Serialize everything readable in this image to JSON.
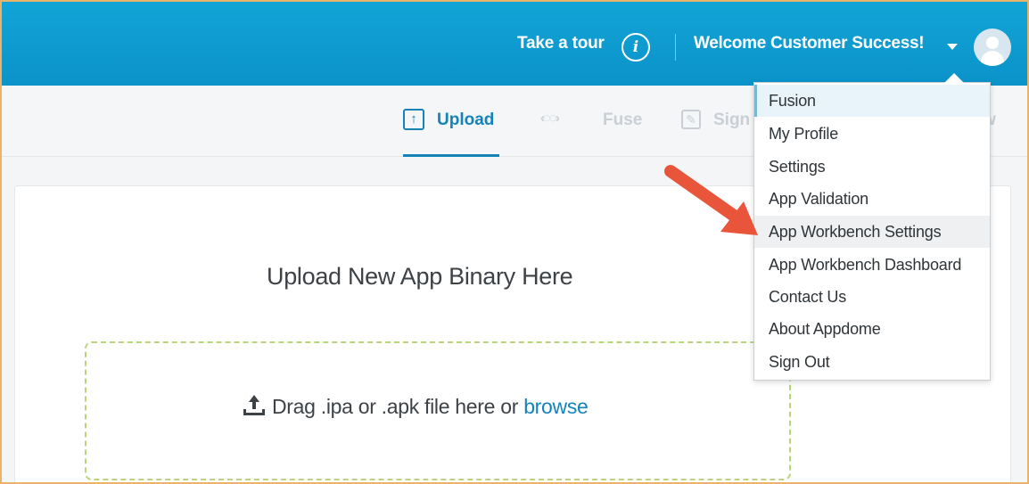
{
  "header": {
    "tour_label": "Take a tour",
    "info_glyph": "i",
    "welcome_label": "Welcome Customer Success!",
    "colors": {
      "bar": "#0b93c9",
      "text": "#ffffff"
    }
  },
  "steps": [
    {
      "label": "Upload",
      "active": true,
      "icon": "upload-box-icon"
    },
    {
      "label": "Fuse",
      "active": false,
      "icon": "fuse-connector-icon"
    },
    {
      "label": "Sign",
      "active": false,
      "icon": "pencil-edit-icon"
    },
    {
      "label": "w",
      "active": false
    }
  ],
  "main": {
    "title": "Upload New App Binary Here",
    "drop_text": "Drag .ipa or .apk file here or ",
    "browse_link": "browse"
  },
  "menu": {
    "items": [
      "Fusion",
      "My Profile",
      "Settings",
      "App Validation",
      "App Workbench Settings",
      "App Workbench Dashboard",
      "Contact Us",
      "About Appdome",
      "Sign Out"
    ],
    "highlighted_index": 4
  },
  "annotation": {
    "arrow_color": "#e8553b"
  }
}
